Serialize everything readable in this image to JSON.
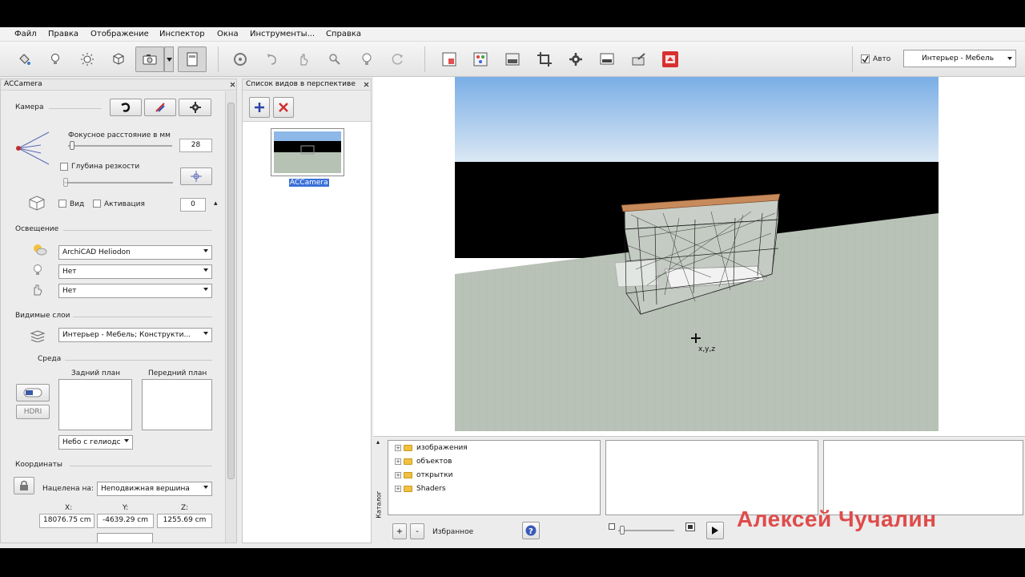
{
  "menu": [
    "Файл",
    "Правка",
    "Отображение",
    "Инспектор",
    "Окна",
    "Инструменты...",
    "Справка"
  ],
  "toolbar": {
    "auto_label": "Авто",
    "auto_checked": true,
    "layer_set": "Интерьер - Мебель"
  },
  "camera_panel": {
    "title": "ACCamera",
    "section_camera": "Камера",
    "focal_label": "Фокусное расстояние в мм",
    "focal_value": "28",
    "dof_label": "Глубина резкости",
    "view_label": "Вид",
    "activation_label": "Активация",
    "activation_value": "0",
    "section_lighting": "Освещение",
    "sun_value": "ArchiCAD Heliodon",
    "light2_value": "Нет",
    "light3_value": "Нет",
    "section_layers": "Видимые слои",
    "layers_value": "Интерьер - Мебель; Конструкти...",
    "section_env": "Среда",
    "background_label": "Задний план",
    "foreground_label": "Передний план",
    "hdri_label": "HDRI",
    "sky_value": "Небо с гелиодс",
    "section_coords": "Координаты",
    "target_label": "Нацелена на:",
    "target_value": "Неподвижная вершина",
    "x_label": "X:",
    "y_label": "Y:",
    "z_label": "Z:",
    "x_value": "18076.75 cm",
    "y_value": "-4639.29 cm",
    "z_value": "1255.69 cm"
  },
  "views_panel": {
    "title": "Список видов в перспективе",
    "selected_view": "ACCamera"
  },
  "viewport": {
    "cursor_label": "x,y,z"
  },
  "catalog": {
    "side_label": "Каталог",
    "tree": [
      "изображения",
      "объектов",
      "открытки",
      "Shaders"
    ],
    "favorites_label": "Избранное"
  },
  "watermark": "Алексей Чучалин",
  "colors": {
    "sky_top": "#7aaee6",
    "sky_bottom": "#dde9f4",
    "ground": "#b8c2b6",
    "watermark": "#e04b4b"
  }
}
